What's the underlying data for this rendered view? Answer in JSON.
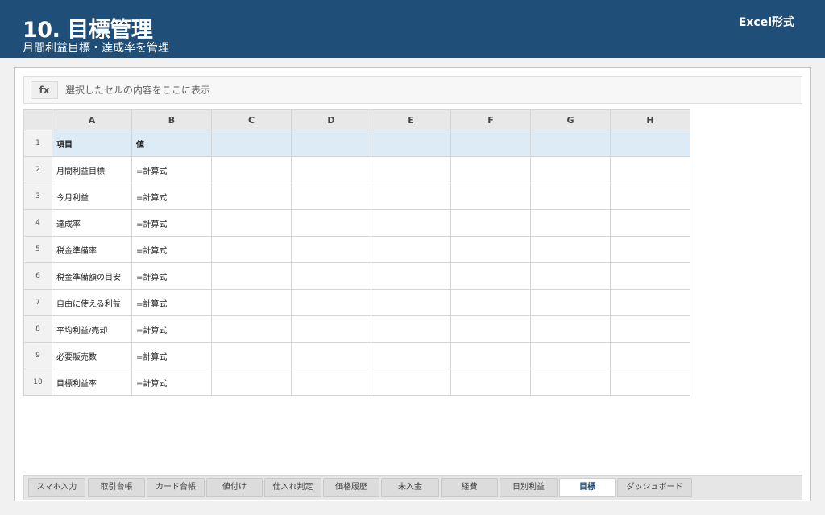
{
  "header": {
    "title": "10. 目標管理",
    "subtitle": "月間利益目標・達成率を管理",
    "format_label": "Excel形式"
  },
  "formula_bar": {
    "fx_label": "fx",
    "text": "選択したセルの内容をここに表示"
  },
  "sheet": {
    "columns": [
      "A",
      "B",
      "C",
      "D",
      "E",
      "F",
      "G",
      "H"
    ],
    "rows": [
      {
        "num": "1",
        "a": "項目",
        "b": "値"
      },
      {
        "num": "2",
        "a": "月間利益目標",
        "b": "=計算式"
      },
      {
        "num": "3",
        "a": "今月利益",
        "b": "=計算式"
      },
      {
        "num": "4",
        "a": "達成率",
        "b": "=計算式"
      },
      {
        "num": "5",
        "a": "税金準備率",
        "b": "=計算式"
      },
      {
        "num": "6",
        "a": "税金準備額の目安",
        "b": "=計算式"
      },
      {
        "num": "7",
        "a": "自由に使える利益",
        "b": "=計算式"
      },
      {
        "num": "8",
        "a": "平均利益/売却",
        "b": "=計算式"
      },
      {
        "num": "9",
        "a": "必要販売数",
        "b": "=計算式"
      },
      {
        "num": "10",
        "a": "目標利益率",
        "b": "=計算式"
      }
    ]
  },
  "tabs": [
    {
      "label": "スマホ入力",
      "active": false
    },
    {
      "label": "取引台帳",
      "active": false
    },
    {
      "label": "カード台帳",
      "active": false
    },
    {
      "label": "値付け",
      "active": false
    },
    {
      "label": "仕入れ判定",
      "active": false
    },
    {
      "label": "価格履歴",
      "active": false
    },
    {
      "label": "未入金",
      "active": false
    },
    {
      "label": "経費",
      "active": false
    },
    {
      "label": "日別利益",
      "active": false
    },
    {
      "label": "目標",
      "active": true
    },
    {
      "label": "ダッシュボード",
      "active": false
    }
  ]
}
